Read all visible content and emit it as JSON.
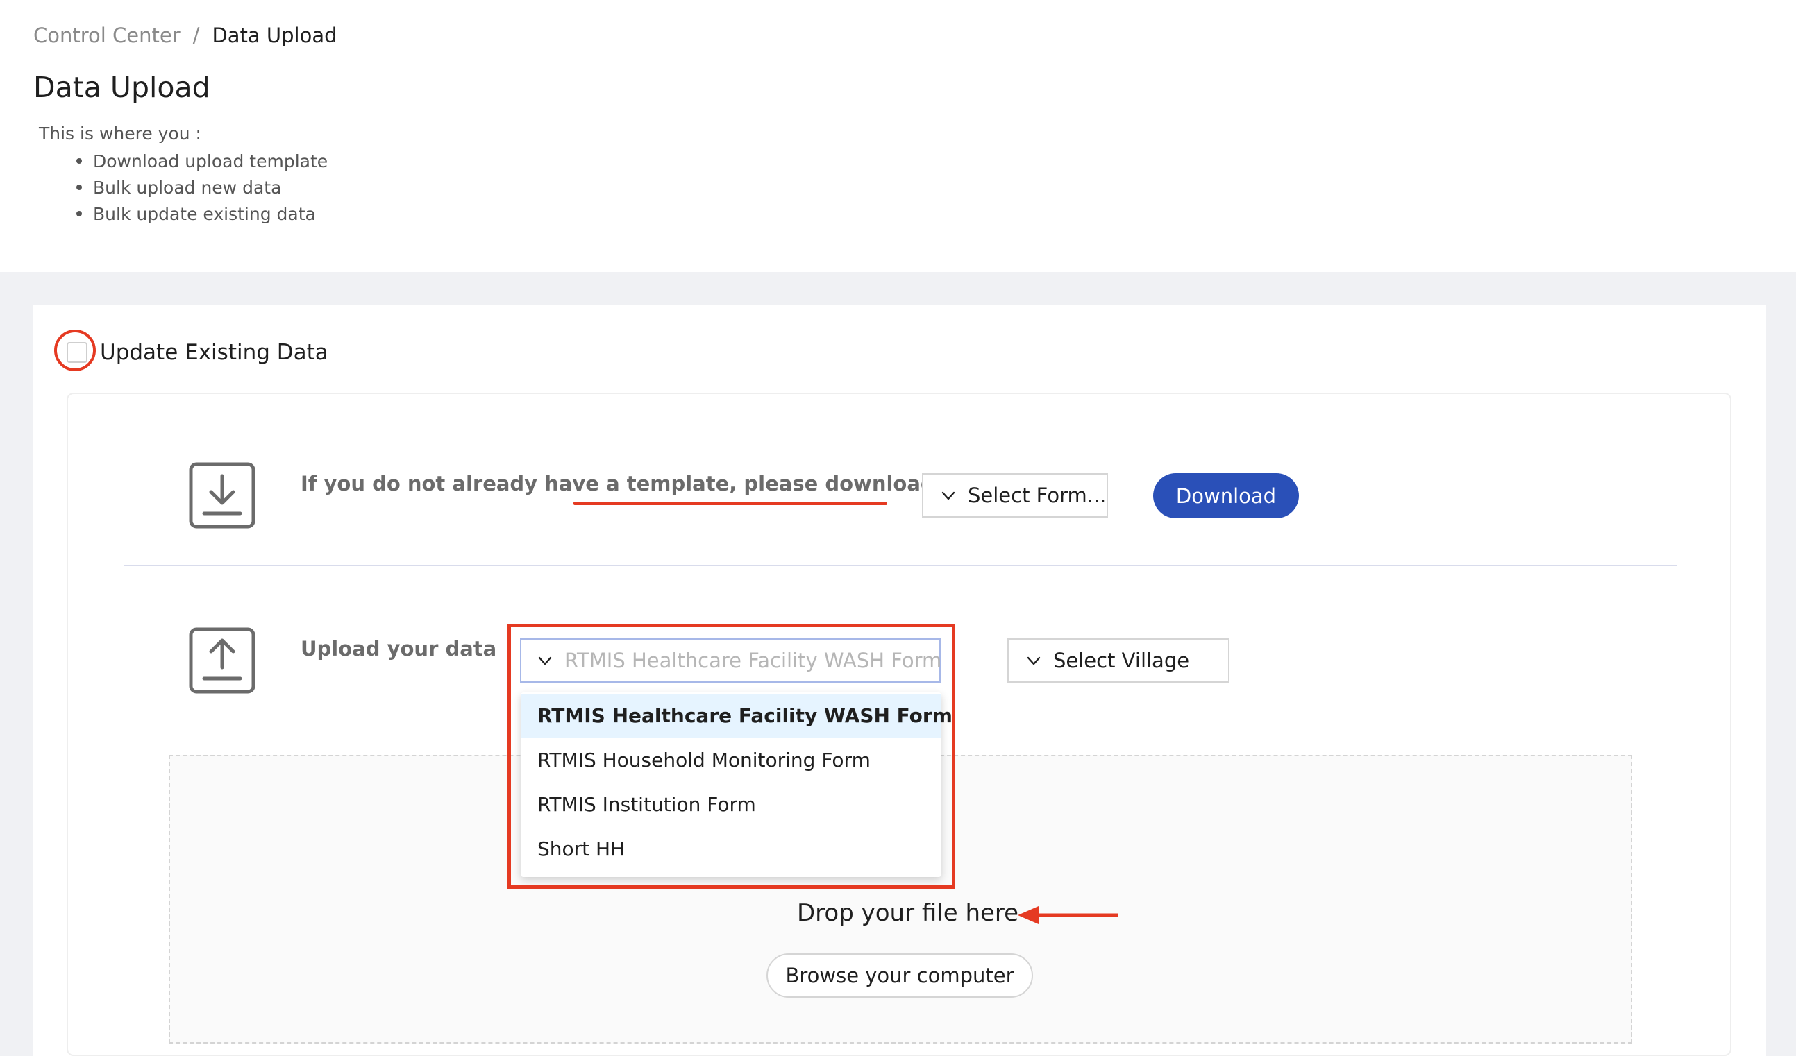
{
  "breadcrumb": {
    "home": "Control Center",
    "separator": "/",
    "current": "Data Upload"
  },
  "page_title": "Data Upload",
  "intro": {
    "lead": "This is where you :",
    "bullets": [
      "Download upload template",
      "Bulk upload new data",
      "Bulk update existing data"
    ]
  },
  "update_existing": {
    "label": "Update Existing Data",
    "checked": false
  },
  "download_section": {
    "text": "If you do not already have a template, please download it",
    "form_select_label": "Select Form...",
    "download_button": "Download",
    "icon": "download-icon"
  },
  "upload_section": {
    "text": "Upload your data",
    "icon": "upload-icon",
    "form_select_placeholder": "RTMIS Healthcare Facility WASH Form",
    "village_select_label": "Select Village",
    "form_options": [
      "RTMIS Healthcare Facility WASH Form",
      "RTMIS Household Monitoring Form",
      "RTMIS Institution Form",
      "Short HH"
    ],
    "highlighted_option": "RTMIS Healthcare Facility WASH Form"
  },
  "dropzone": {
    "text": "Drop your file here",
    "browse_button": "Browse your computer"
  },
  "colors": {
    "accent": "#2a50b8",
    "annotation": "#e53a22",
    "option_highlight": "#e6f4ff"
  }
}
